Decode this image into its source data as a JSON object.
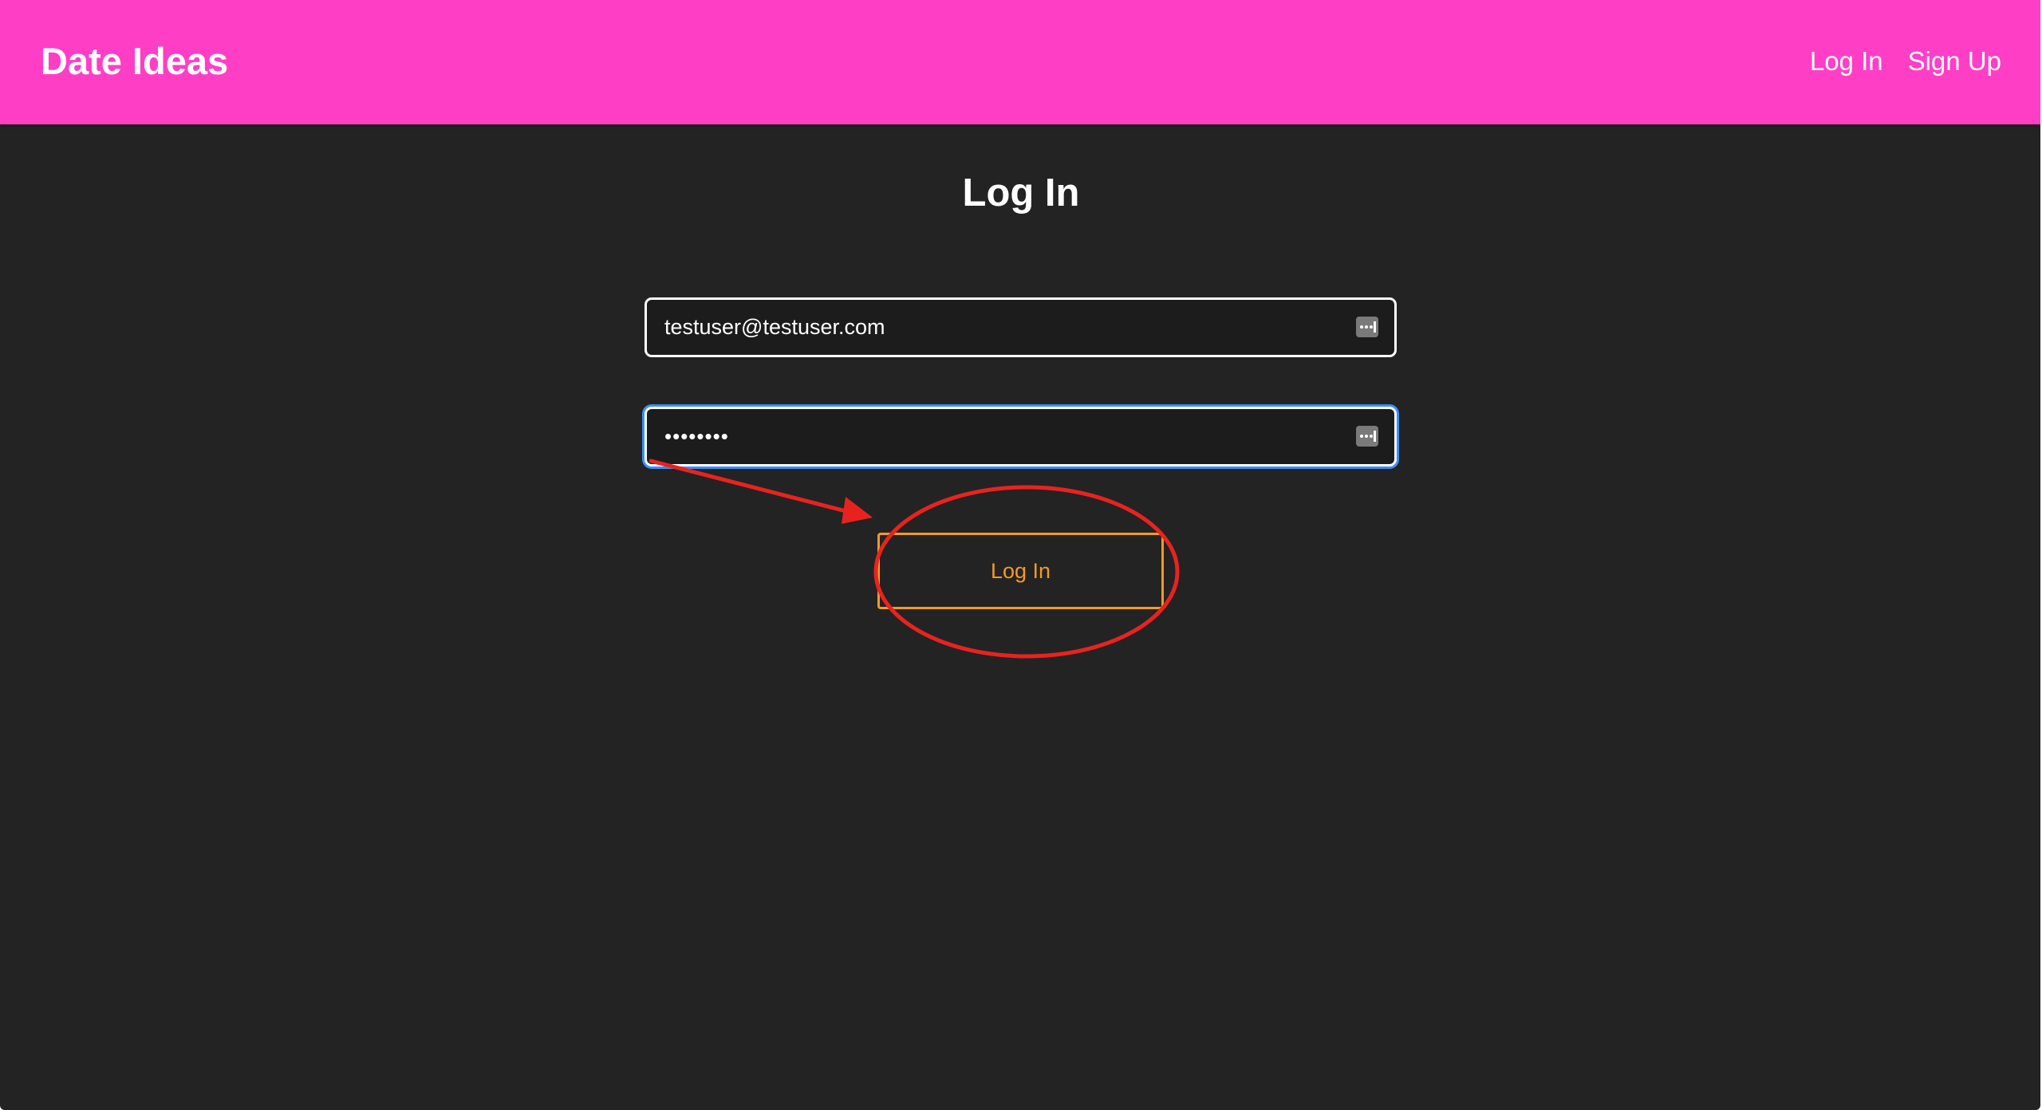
{
  "navbar": {
    "brand": "Date Ideas",
    "links": [
      {
        "label": "Log In"
      },
      {
        "label": "Sign Up"
      }
    ],
    "color": "#ff3ec6"
  },
  "main": {
    "title": "Log In",
    "email_value": "testuser@testuser.com",
    "password_value": "••••••••",
    "submit_label": "Log In",
    "button_color": "#f29a28",
    "background": "#232323"
  },
  "annotation": {
    "color": "#e8231f",
    "shapes": [
      "arrow",
      "ellipse"
    ]
  }
}
